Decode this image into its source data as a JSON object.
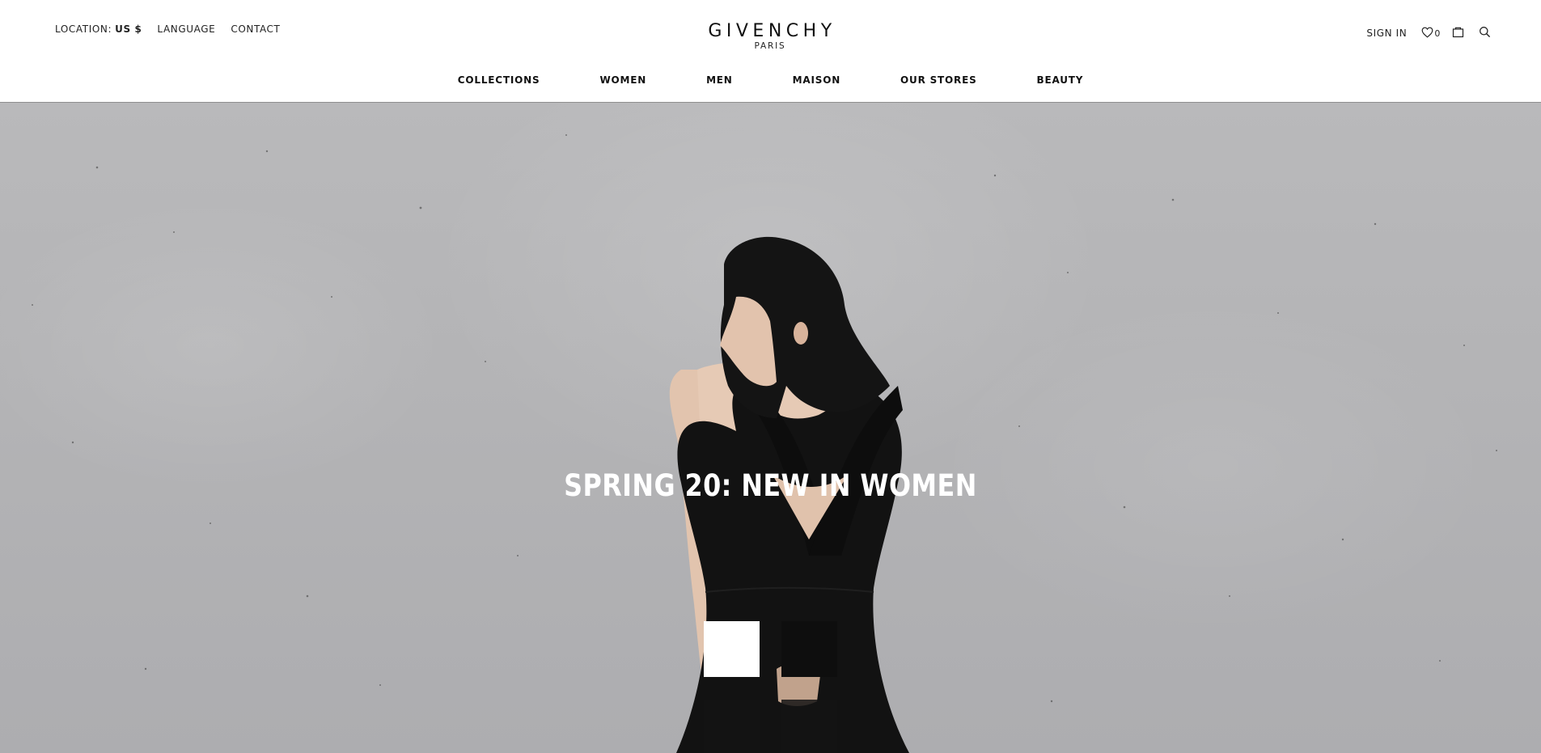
{
  "header": {
    "location_label": "LOCATION:",
    "location_value": "US $",
    "language_label": "LANGUAGE",
    "contact_label": "CONTACT",
    "brand": "GIVENCHY",
    "brand_city": "PARIS",
    "signin_label": "SIGN IN",
    "wishlist_count": "0",
    "icons": [
      "heart-icon",
      "shopping-bag-icon",
      "search-icon"
    ]
  },
  "nav": {
    "items": [
      "COLLECTIONS",
      "WOMEN",
      "MEN",
      "MAISON",
      "OUR STORES",
      "BEAUTY"
    ]
  },
  "hero": {
    "title": "SPRING 20: NEW IN WOMEN",
    "background_color": "#b4b4b6",
    "tiles": [
      "white",
      "dark",
      "dark",
      "dark"
    ]
  }
}
